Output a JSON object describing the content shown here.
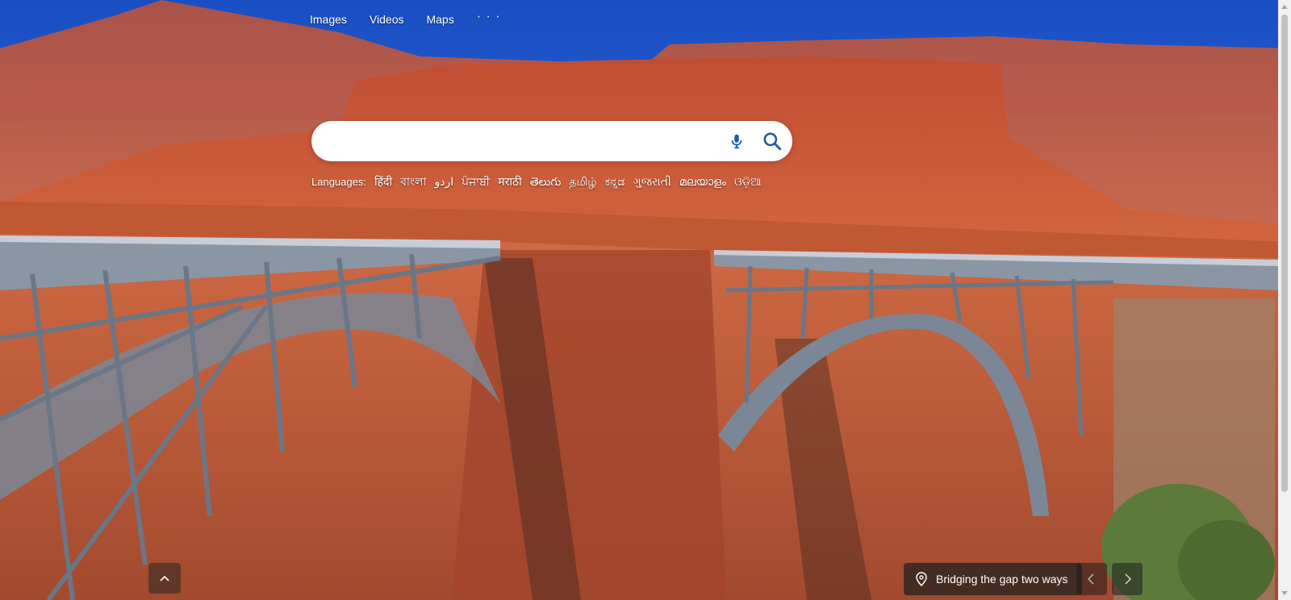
{
  "nav": {
    "items": [
      {
        "label": "Images"
      },
      {
        "label": "Videos"
      },
      {
        "label": "Maps"
      }
    ],
    "more_label": "· · ·"
  },
  "search": {
    "value": "",
    "placeholder": "",
    "mic_icon": "microphone-icon",
    "search_icon": "search-icon"
  },
  "languages": {
    "label": "Languages:",
    "items": [
      "हिंदी",
      "বাংলা",
      "اردو",
      "ਪੰਜਾਬੀ",
      "मराठी",
      "తెలుగు",
      "தமிழ்",
      "ಕನ್ನಡ",
      "ગુજરાતી",
      "മലയാളം",
      "ଓଡ଼ିଆ"
    ]
  },
  "caption": {
    "text": "Bridging the gap two ways",
    "icon": "location-pin-icon"
  },
  "controls": {
    "scroll_up_icon": "chevron-up-icon",
    "prev_icon": "chevron-left-icon",
    "next_icon": "chevron-right-icon"
  },
  "colors": {
    "sky": "#1f5fd0",
    "cliff_red": "#c0573a",
    "bridge_steel": "#8b98a8"
  }
}
